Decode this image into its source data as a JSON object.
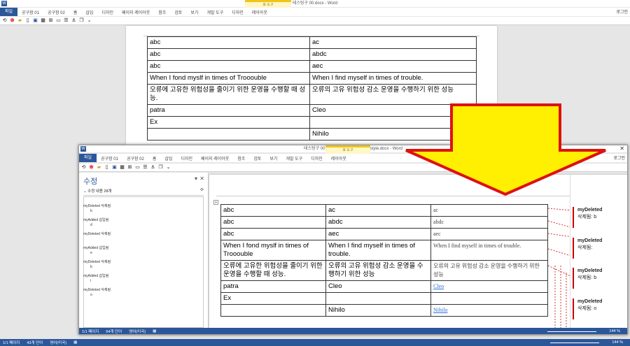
{
  "back_window": {
    "title": "테스팅구 00.docx - Word",
    "ribbon_group": "표 도구",
    "tabs": [
      "파일",
      "공구함 01",
      "공구함 02",
      "홈",
      "삽입",
      "디자인",
      "페이지 레이아웃",
      "참조",
      "검토",
      "보기",
      "개발 도구"
    ],
    "ctx_tabs": [
      "디자인",
      "레이아웃"
    ],
    "login": "로그인",
    "table": [
      [
        "abc",
        "ac"
      ],
      [
        "abc",
        "abdc"
      ],
      [
        "abc",
        "aec"
      ],
      [
        "When I fond myslf in times of Trooouble",
        "When I find myself in times of trouble."
      ],
      [
        "오류에 고유한 위험성을 줄이기 위한 운영을 수행할 때 성능.",
        "오류의 고유 위험성 감소 운영을 수행하기 위한 성능"
      ],
      [
        "patra",
        "Cleo"
      ],
      [
        "Ex",
        ""
      ],
      [
        "",
        "Nihilo"
      ]
    ],
    "status": {
      "page": "1/1 페이지",
      "words": "43개 단어",
      "lang": "영어(미국)",
      "zoom": "144 %"
    }
  },
  "front_window": {
    "title": "테스팅구 00 _ComparedMSWordTCstyle.docx - Word",
    "ribbon_group": "표 도구",
    "tabs": [
      "파일",
      "공구함 01",
      "공구함 02",
      "홈",
      "삽입",
      "디자인",
      "페이지 레이아웃",
      "참조",
      "검토",
      "보기",
      "개발 도구"
    ],
    "ctx_tabs": [
      "디자인",
      "레이아웃"
    ],
    "login": "로그인",
    "pane": {
      "title": "수정",
      "summary": "수정 내용 28개",
      "items": [
        {
          "author": "myDeleted",
          "action": "삭제됨",
          "content": "b"
        },
        {
          "author": "myAdded",
          "action": "삽입됨",
          "content": "d"
        },
        {
          "author": "myDeleted",
          "action": "삭제됨",
          "content": ""
        },
        {
          "author": "myAdded",
          "action": "삽입됨",
          "content": "e"
        },
        {
          "author": "myDeleted",
          "action": "삭제됨",
          "content": "b"
        },
        {
          "author": "myAdded",
          "action": "삽입됨",
          "content": "i"
        },
        {
          "author": "myDeleted",
          "action": "삭제됨",
          "content": "o"
        }
      ]
    },
    "table": [
      [
        "abc",
        "ac",
        "ac"
      ],
      [
        "abc",
        "abdc",
        "abdc"
      ],
      [
        "abc",
        "aec",
        "aec"
      ],
      [
        "When I fond myslf in times of Trooouble",
        "When I find myself in times of trouble.",
        "When I find myself in times of trouble."
      ],
      [
        "오류에 고유한 위험성을 줄이기 위한 운영을 수행할 때 성능.",
        "오류의 고유 위험성 감소 운영을 수행하기 위한 성능",
        "오류의 고유 위험성 감소 운영을 수행하기 위한 성능"
      ],
      [
        "patra",
        "Cleo",
        "Cleo"
      ],
      [
        "Ex",
        "",
        ""
      ],
      [
        "",
        "Nihilo",
        "Nihilo"
      ]
    ],
    "balloons": [
      {
        "author": "myDeleted",
        "label": "삭제됨:",
        "content": "b"
      },
      {
        "author": "myDeleted",
        "label": "삭제됨:",
        "content": ""
      },
      {
        "author": "myDeleted",
        "label": "삭제됨:",
        "content": "b"
      },
      {
        "author": "myDeleted",
        "label": "삭제됨:",
        "content": "o"
      }
    ],
    "status": {
      "page": "1/1 페이지",
      "words": "64개 단어",
      "lang": "영어(미국)",
      "zoom": "144 %"
    }
  },
  "colors": {
    "word_blue": "#2b579a",
    "arrow_fill": "#ffef00",
    "arrow_stroke": "#d11",
    "ctx_tab": "#fff7c7",
    "deleted_line": "#c00"
  }
}
